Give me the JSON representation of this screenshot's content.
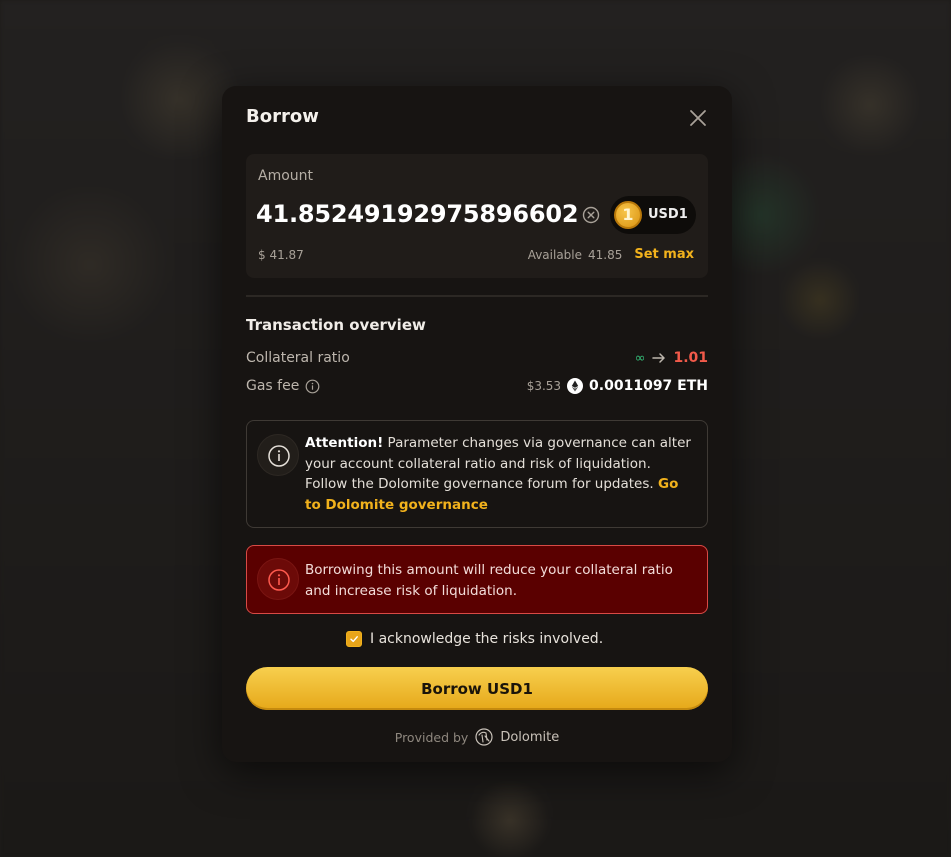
{
  "modal": {
    "title": "Borrow",
    "amount_label": "Amount",
    "amount_value": "41.852491929758966027",
    "token": {
      "symbol": "USD1",
      "coin_glyph": "1",
      "color": "#f2b21c"
    },
    "usd_value": "$ 41.87",
    "available_label": "Available",
    "available_value": "41.85",
    "set_max_label": "Set max"
  },
  "overview": {
    "title": "Transaction overview",
    "collateral_label": "Collateral ratio",
    "collateral_from": "∞",
    "collateral_to": "1.01",
    "gas_label": "Gas fee",
    "gas_usd": "$3.53",
    "gas_eth": "0.0011097 ETH"
  },
  "attention": {
    "heading": "Attention!",
    "text": " Parameter changes via governance can alter your account collateral ratio and risk of liquidation. Follow the Dolomite governance forum for updates. ",
    "link": "Go to Dolomite governance"
  },
  "danger": {
    "text": "Borrowing this amount will reduce your collateral ratio and increase risk of liquidation."
  },
  "acknowledge": {
    "label": "I acknowledge the risks involved.",
    "checked": true
  },
  "borrow_button": "Borrow USD1",
  "footer": {
    "provided_by": "Provided by",
    "brand": "Dolomite"
  },
  "colors": {
    "accent": "#f2b21c",
    "danger": "#f25a4a",
    "danger_bg": "#5a0000",
    "positive": "#35c07a"
  },
  "icons": [
    "close-icon",
    "clear-icon",
    "info-icon",
    "arrow-right-icon",
    "eth-icon",
    "check-icon",
    "dolomite-logo-icon"
  ]
}
